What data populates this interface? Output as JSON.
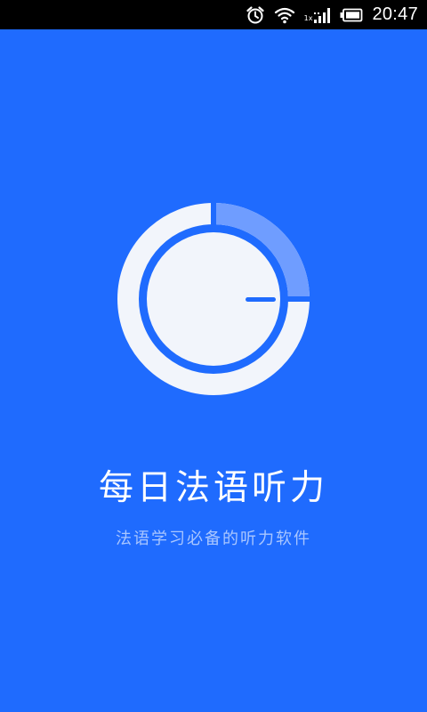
{
  "status_bar": {
    "time": "20:47",
    "signal_label": "1x",
    "icons": [
      "alarm-icon",
      "wifi-icon",
      "signal-icon",
      "battery-icon"
    ]
  },
  "splash": {
    "title": "每日法语听力",
    "subtitle": "法语学习必备的听力软件",
    "logo_icon": "timer-dial-icon"
  },
  "colors": {
    "background": "#1f6bfe",
    "ring_white": "#f2f5fb",
    "ring_highlight": "#6f9dff",
    "subtitle": "#a9c6ff"
  }
}
